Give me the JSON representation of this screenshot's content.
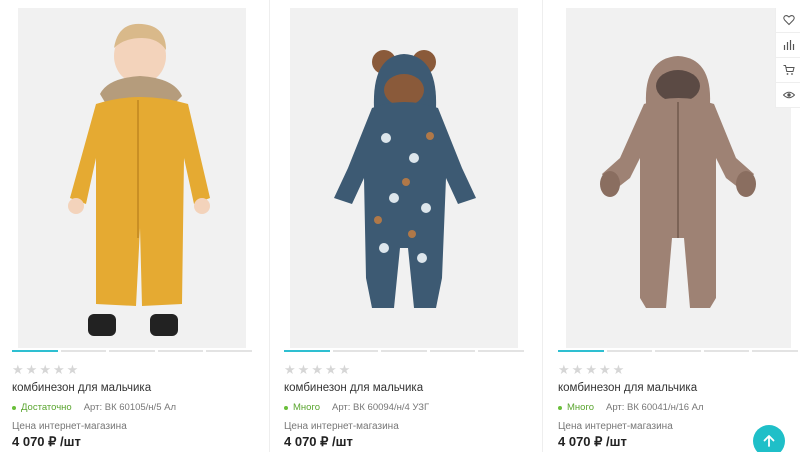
{
  "products": [
    {
      "title": "комбинезон для мальчика",
      "stock": "Достаточно",
      "sku": "Арт: ВК 60105/н/5 Ал",
      "price_label": "Цена интернет-магазина",
      "price": "4 070 ₽ /шт",
      "image": "yellow-snowsuit-child"
    },
    {
      "title": "комбинезон для мальчика",
      "stock": "Много",
      "sku": "Арт: ВК 60094/н/4 УЗГ",
      "price_label": "Цена интернет-магазина",
      "price": "4 070 ₽ /шт",
      "image": "navy-bear-snowsuit"
    },
    {
      "title": "комбинезон для мальчика",
      "stock": "Много",
      "sku": "Арт: ВК 60041/н/16 Ал",
      "price_label": "Цена интернет-магазина",
      "price": "4 070 ₽ /шт",
      "image": "brown-snowsuit"
    }
  ],
  "rating": {
    "filled": 0,
    "total": 5
  },
  "side_tools": [
    "heart-icon",
    "compare-icon",
    "cart-icon",
    "eye-icon"
  ],
  "colors": {
    "accent": "#2ebfd1",
    "in_stock": "#5aa52f",
    "scroll_button": "#1fbfc8"
  }
}
